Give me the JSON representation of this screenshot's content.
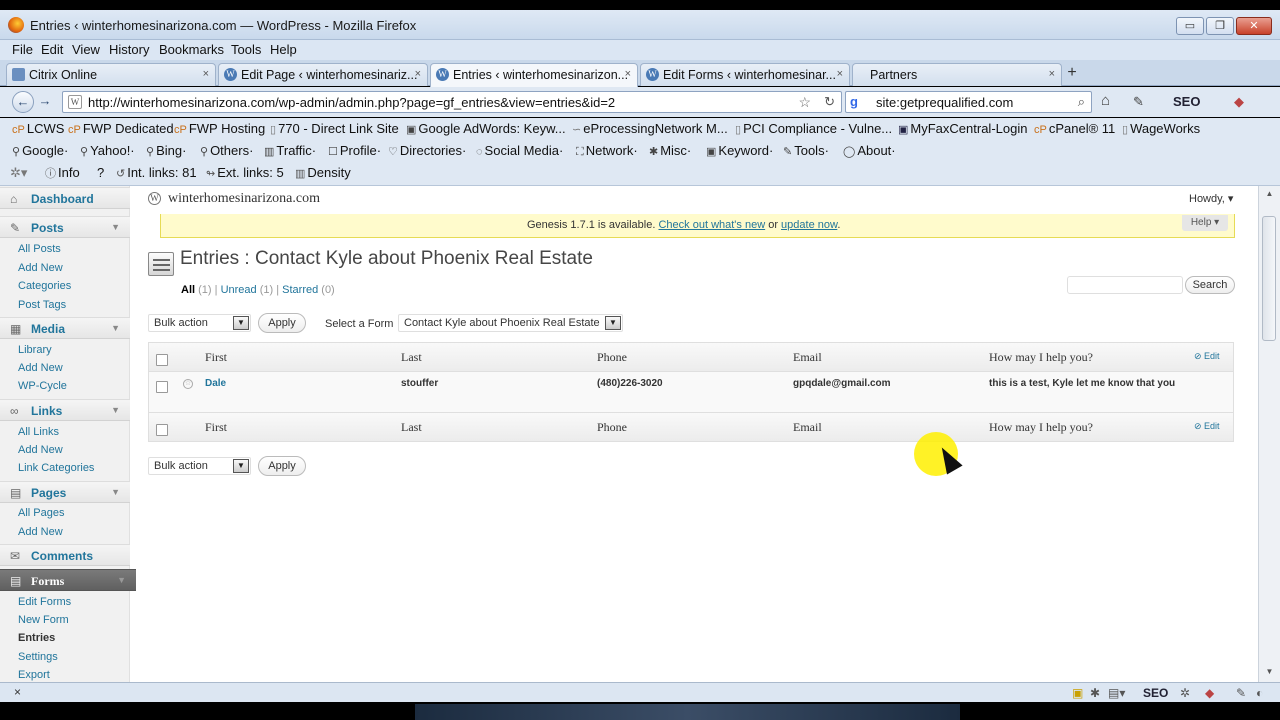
{
  "window": {
    "title": "Entries ‹ winterhomesinarizona.com — WordPress - Mozilla Firefox",
    "min_label": "▭",
    "max_label": "❐",
    "close_label": "✕"
  },
  "menu": [
    "File",
    "Edit",
    "View",
    "History",
    "Bookmarks",
    "Tools",
    "Help"
  ],
  "tabs": [
    {
      "label": "Citrix Online",
      "close": "×"
    },
    {
      "label": "Edit Page ‹ winterhomesinariz...",
      "close": "×"
    },
    {
      "label": "Entries ‹ winterhomesinarizon...",
      "close": "×"
    },
    {
      "label": "Edit Forms ‹ winterhomesinar...",
      "close": "×"
    },
    {
      "label": "Partners",
      "close": "×"
    }
  ],
  "new_tab_label": "+",
  "nav": {
    "back": "←",
    "forward": "→",
    "url": "http://winterhomesinarizona.com/wp-admin/admin.php?page=gf_entries&view=entries&id=2",
    "search_value": "site:getprequalified.com",
    "search_engine_glyph": "g",
    "home": "⌂",
    "seo_label": "SEO"
  },
  "bookmarks_row1": [
    "LCWS",
    "FWP Dedicated",
    "FWP Hosting",
    "770 - Direct Link Site",
    "Google AdWords: Keyw...",
    "eProcessingNetwork M...",
    "PCI Compliance - Vulne...",
    "MyFaxCentral-Login",
    "cPanel® 11",
    "WageWorks"
  ],
  "bookmarks_row2": [
    "Google·",
    "Yahoo!·",
    "Bing·",
    "Others·",
    "Traffic·",
    "Profile·",
    "Directories·",
    "Social Media·",
    "Network·",
    "Misc·",
    "Keyword·",
    "Tools·",
    "About·"
  ],
  "seo_toolbar": {
    "info": "Info",
    "question": "?",
    "int_links": "Int. links: 81",
    "ext_links": "Ext. links: 5",
    "density": "Density"
  },
  "wp": {
    "site_name": "winterhomesinarizona.com",
    "howdy": "Howdy, ▾",
    "help": "Help ▾",
    "notice": {
      "text1": "Genesis 1.7.1 is available.",
      "link1": "Check out what's new",
      "text2": "or",
      "link2": "update now",
      "text3": "."
    },
    "sidebar": [
      {
        "label": "Dashboard",
        "icon": "⌂",
        "type": "head"
      },
      {
        "label": "Posts",
        "icon": "✎",
        "type": "head"
      },
      {
        "label": "All Posts",
        "type": "item"
      },
      {
        "label": "Add New",
        "type": "item"
      },
      {
        "label": "Categories",
        "type": "item"
      },
      {
        "label": "Post Tags",
        "type": "item"
      },
      {
        "label": "Media",
        "icon": "▦",
        "type": "head"
      },
      {
        "label": "Library",
        "type": "item"
      },
      {
        "label": "Add New",
        "type": "item"
      },
      {
        "label": "WP-Cycle",
        "type": "item"
      },
      {
        "label": "Links",
        "icon": "∞",
        "type": "head"
      },
      {
        "label": "All Links",
        "type": "item"
      },
      {
        "label": "Add New",
        "type": "item"
      },
      {
        "label": "Link Categories",
        "type": "item"
      },
      {
        "label": "Pages",
        "icon": "▤",
        "type": "head"
      },
      {
        "label": "All Pages",
        "type": "item"
      },
      {
        "label": "Add New",
        "type": "item"
      },
      {
        "label": "Comments",
        "icon": "✉",
        "type": "head"
      },
      {
        "label": "Forms",
        "icon": "▤",
        "type": "head"
      },
      {
        "label": "Edit Forms",
        "type": "item"
      },
      {
        "label": "New Form",
        "type": "item"
      },
      {
        "label": "Entries",
        "type": "item"
      },
      {
        "label": "Settings",
        "type": "item"
      },
      {
        "label": "Export",
        "type": "item"
      }
    ],
    "page_title": "Entries : Contact Kyle about Phoenix Real Estate",
    "filters": {
      "all": "All",
      "all_count": "(1)",
      "unread": "Unread",
      "unread_count": "(1)",
      "starred": "Starred",
      "starred_count": "(0)",
      "sep": "|"
    },
    "search_button": "Search",
    "bulk_action": "Bulk action",
    "apply": "Apply",
    "select_form_label": "Select a Form",
    "selected_form": "Contact Kyle about Phoenix Real Estate",
    "columns": [
      "First",
      "Last",
      "Phone",
      "Email",
      "How may I help you?"
    ],
    "edit_label": "Edit",
    "rows": [
      {
        "first": "Dale",
        "last": "stouffer",
        "phone": "(480)226-3020",
        "email": "gpqdale@gmail.com",
        "help": "this is a test, Kyle let me know that you"
      }
    ]
  },
  "status": {
    "close": "×"
  }
}
